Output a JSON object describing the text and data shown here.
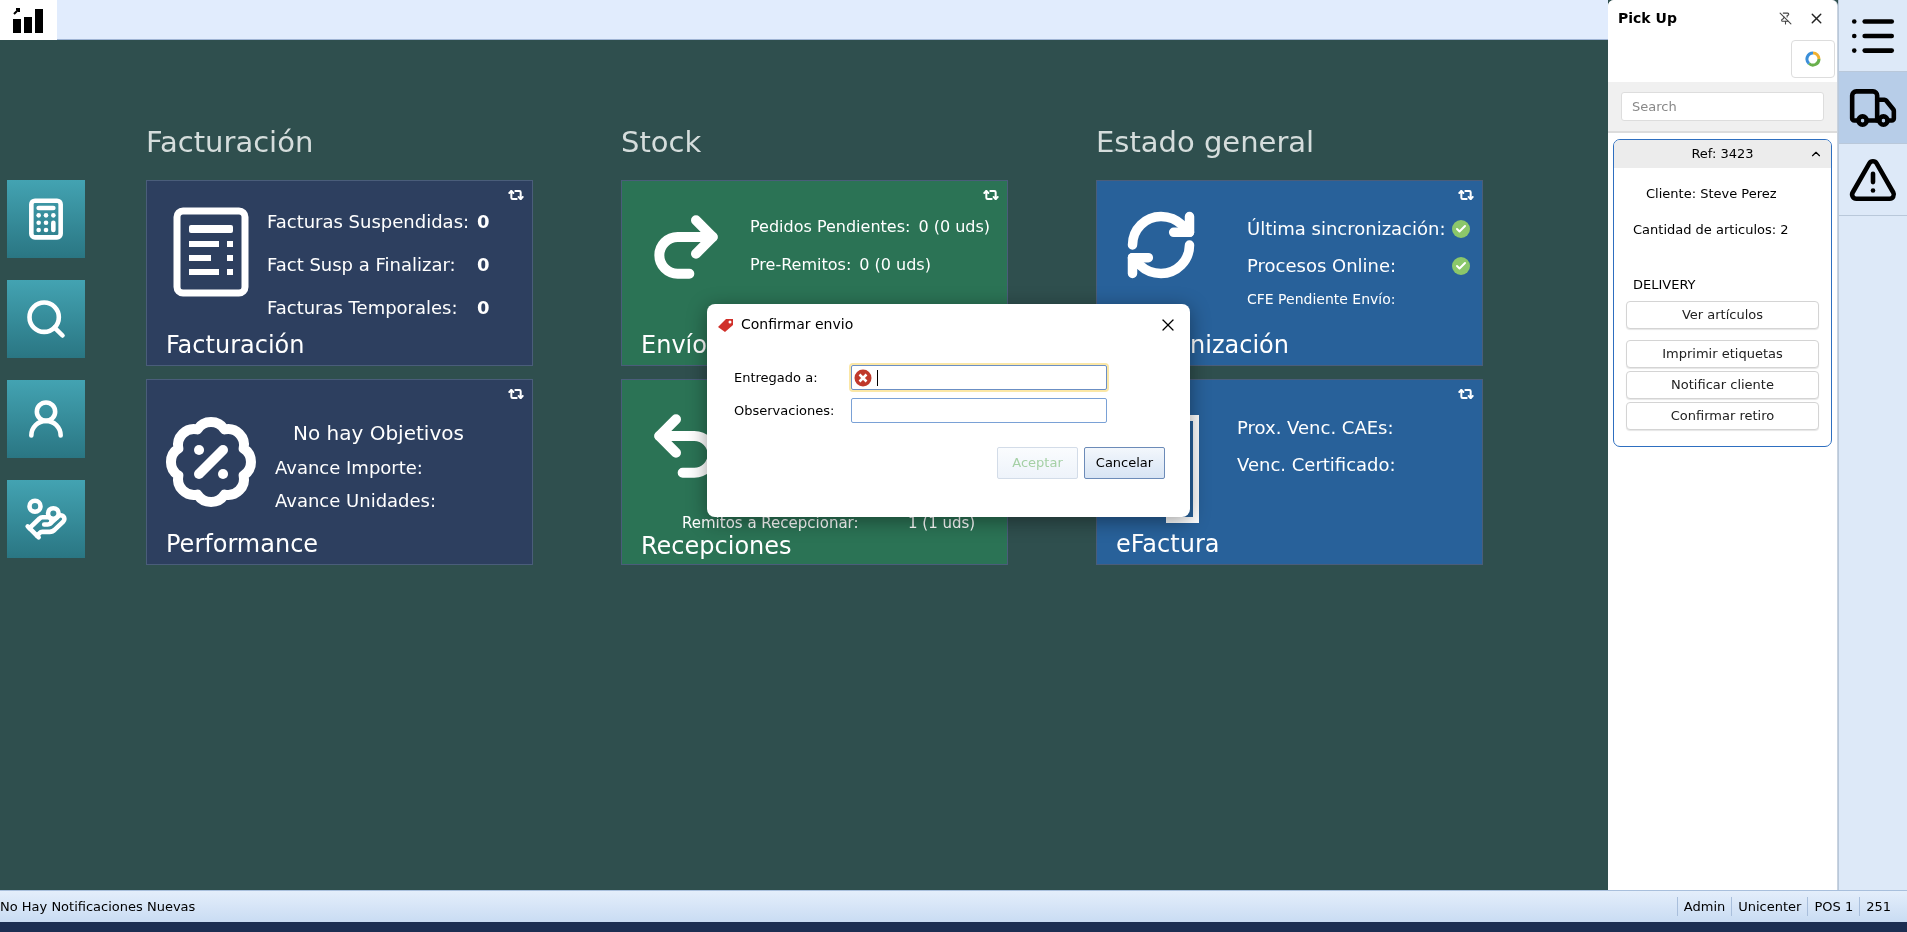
{
  "status_bar": {
    "message": "No Hay Notificaciones Nuevas",
    "items": [
      "Admin",
      "Unicenter",
      "POS 1",
      "251"
    ]
  },
  "sections": [
    {
      "title": "Facturación",
      "tiles": [
        {
          "kind": "invoices",
          "title": "Facturación",
          "rows": [
            {
              "label": "Facturas Suspendidas:",
              "value": "0"
            },
            {
              "label": "Fact Susp a Finalizar:",
              "value": "0"
            },
            {
              "label": "Facturas Temporales:",
              "value": "0"
            }
          ]
        },
        {
          "kind": "performance",
          "title": "Performance",
          "heading": "No hay Objetivos",
          "rows": [
            {
              "label": "Avance Importe:"
            },
            {
              "label": "Avance Unidades:"
            }
          ]
        }
      ]
    },
    {
      "title": "Stock",
      "tiles": [
        {
          "kind": "sent",
          "title": "Envío",
          "rows": [
            {
              "label": "Pedidos Pendientes:",
              "value": "0 (0 uds)"
            },
            {
              "label": "Pre-Remitos:",
              "value": "0 (0 uds)"
            }
          ]
        },
        {
          "kind": "received",
          "title": "Recepciones",
          "rows": [
            {
              "label": "Remitos a Recepcionar:",
              "value": "1 (1 uds)"
            }
          ]
        }
      ]
    },
    {
      "title": "Estado general",
      "tiles": [
        {
          "kind": "sync",
          "title": "nización",
          "rows": [
            {
              "label": "Última sincronización:",
              "ok": true
            },
            {
              "label": "Procesos Online:",
              "ok": true
            },
            {
              "label": "CFE Pendiente Envío:"
            }
          ]
        },
        {
          "kind": "efactura",
          "title": "eFactura",
          "rows": [
            {
              "label": "Prox. Venc. CAEs:"
            },
            {
              "label": "Venc. Certificado:"
            }
          ]
        }
      ]
    }
  ],
  "dialog": {
    "title": "Confirmar envio",
    "fields": [
      {
        "label": "Entregado a:",
        "error": true,
        "focused": true
      },
      {
        "label": "Observaciones:",
        "error": false,
        "focused": false
      }
    ],
    "buttons": [
      {
        "label": "Aceptar",
        "disabled": true
      },
      {
        "label": "Cancelar",
        "disabled": false
      }
    ]
  },
  "pick_up": {
    "title": "Pick Up",
    "search": {
      "placeholder": "Search"
    },
    "card": {
      "title": "Ref: 3423",
      "expanded": true,
      "client": "Cliente: Steve Perez",
      "count": "Cantidad de articulos: 2",
      "type": "DELIVERY",
      "buttons": [
        "Ver artículos",
        "Imprimir etiquetas",
        "Notificar cliente",
        "Confirmar retiro"
      ]
    }
  },
  "side_tabs": [
    {
      "kind": "list",
      "selected": false
    },
    {
      "kind": "truck",
      "selected": true
    },
    {
      "kind": "warning",
      "selected": false
    }
  ]
}
